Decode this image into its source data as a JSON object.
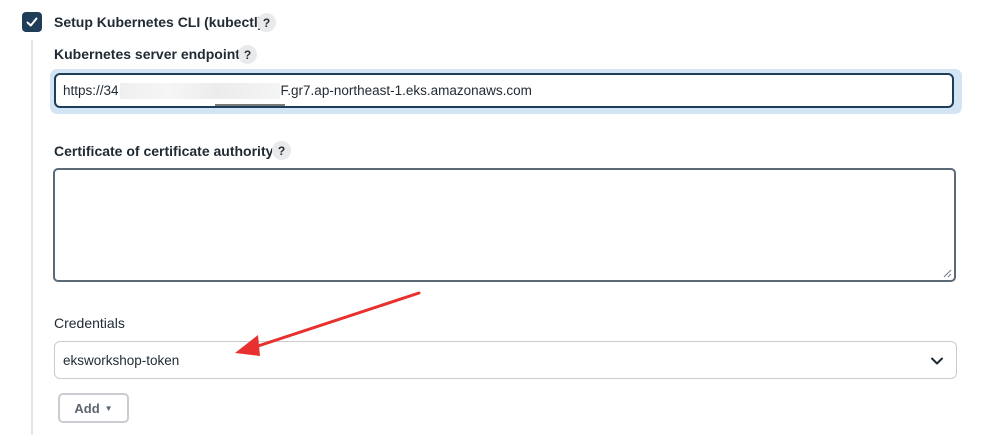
{
  "kubectl_setup": {
    "label": "Setup Kubernetes CLI (kubectl)",
    "checked": true,
    "help": "?"
  },
  "endpoint": {
    "label": "Kubernetes server endpoint",
    "help": "?",
    "value_prefix": "https://34",
    "value_suffix": "F.gr7.ap-northeast-1.eks.amazonaws.com"
  },
  "certificate": {
    "label": "Certificate of certificate authority",
    "help": "?",
    "value": ""
  },
  "credentials": {
    "label": "Credentials",
    "selected": "eksworkshop-token"
  },
  "add_button": {
    "label": "Add"
  },
  "colors": {
    "accent": "#1e3d59",
    "annotation_arrow": "#e8312f"
  }
}
